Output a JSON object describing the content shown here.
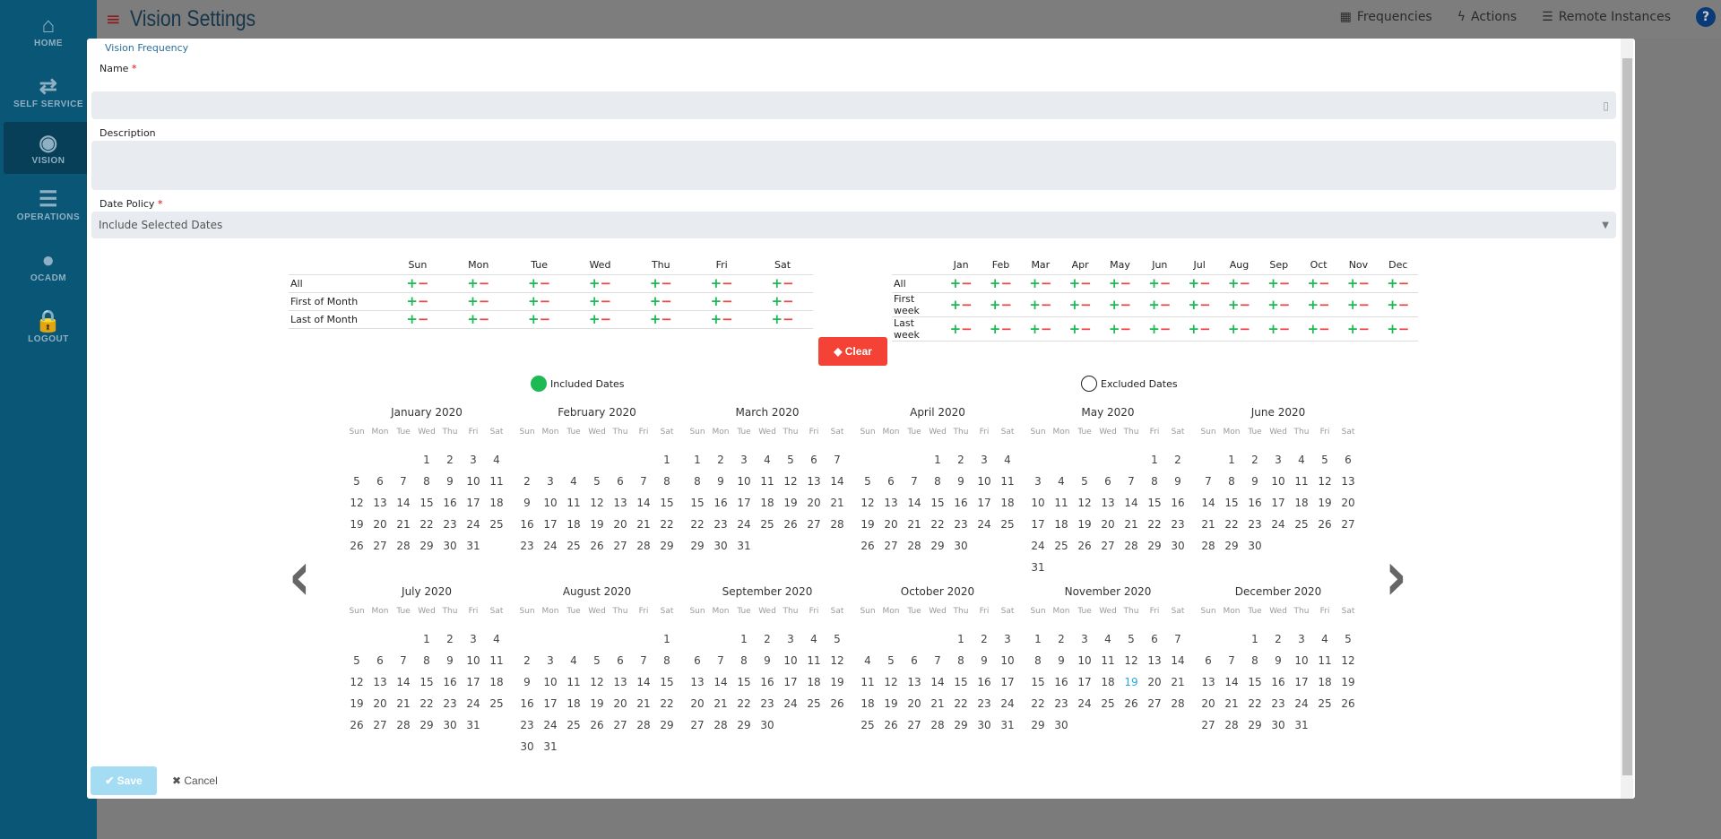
{
  "sidebar": {
    "items": [
      {
        "label": "HOME",
        "icon": "home-icon",
        "glyph": "⌂"
      },
      {
        "label": "SELF SERVICE",
        "icon": "swap-icon",
        "glyph": "⇄"
      },
      {
        "label": "VISION",
        "icon": "eye-icon",
        "glyph": "◉",
        "active": true
      },
      {
        "label": "OPERATIONS",
        "icon": "checklist-icon",
        "glyph": "☰"
      },
      {
        "label": "OCADM",
        "icon": "user-icon",
        "glyph": "●"
      },
      {
        "label": "LOGOUT",
        "icon": "lock-icon",
        "glyph": "🔒"
      }
    ]
  },
  "header": {
    "title": "Vision Settings",
    "nav": [
      {
        "label": "Frequencies",
        "icon": "calendar-icon",
        "glyph": "▦"
      },
      {
        "label": "Actions",
        "icon": "bolt-icon",
        "glyph": "ϟ"
      },
      {
        "label": "Remote Instances",
        "icon": "server-icon",
        "glyph": "☰"
      }
    ],
    "help": "?"
  },
  "modal": {
    "heading": "Vision Frequency",
    "name_label": "Name",
    "name_value": "",
    "description_label": "Description",
    "description_value": "",
    "date_policy_label": "Date Policy",
    "date_policy_value": "Include Selected Dates",
    "required_mark": "*",
    "weekday_table": {
      "columns": [
        "Sun",
        "Mon",
        "Tue",
        "Wed",
        "Thu",
        "Fri",
        "Sat"
      ],
      "rows": [
        "All",
        "First of Month",
        "Last of Month"
      ]
    },
    "month_table": {
      "columns": [
        "Jan",
        "Feb",
        "Mar",
        "Apr",
        "May",
        "Jun",
        "Jul",
        "Aug",
        "Sep",
        "Oct",
        "Nov",
        "Dec"
      ],
      "rows": [
        "All",
        "First week",
        "Last week"
      ]
    },
    "plus": "+",
    "minus": "−",
    "clear_label": "Clear",
    "legend": {
      "included": "Included Dates",
      "excluded": "Excluded Dates",
      "included_color": "#1db954"
    },
    "calendar": {
      "weekdays": [
        "Sun",
        "Mon",
        "Tue",
        "Wed",
        "Thu",
        "Fri",
        "Sat"
      ],
      "today": {
        "month": 11,
        "day": 19
      },
      "months": [
        {
          "title": "January 2020",
          "first_weekday": 3,
          "days": 31
        },
        {
          "title": "February 2020",
          "first_weekday": 6,
          "days": 29
        },
        {
          "title": "March 2020",
          "first_weekday": 0,
          "days": 31
        },
        {
          "title": "April 2020",
          "first_weekday": 3,
          "days": 30
        },
        {
          "title": "May 2020",
          "first_weekday": 5,
          "days": 31
        },
        {
          "title": "June 2020",
          "first_weekday": 1,
          "days": 30
        },
        {
          "title": "July 2020",
          "first_weekday": 3,
          "days": 31
        },
        {
          "title": "August 2020",
          "first_weekday": 6,
          "days": 31
        },
        {
          "title": "September 2020",
          "first_weekday": 2,
          "days": 30
        },
        {
          "title": "October 2020",
          "first_weekday": 4,
          "days": 31
        },
        {
          "title": "November 2020",
          "first_weekday": 0,
          "days": 30
        },
        {
          "title": "December 2020",
          "first_weekday": 2,
          "days": 31
        }
      ]
    },
    "prev": "‹",
    "next": "›",
    "save_label": "Save",
    "cancel_label": "Cancel"
  }
}
